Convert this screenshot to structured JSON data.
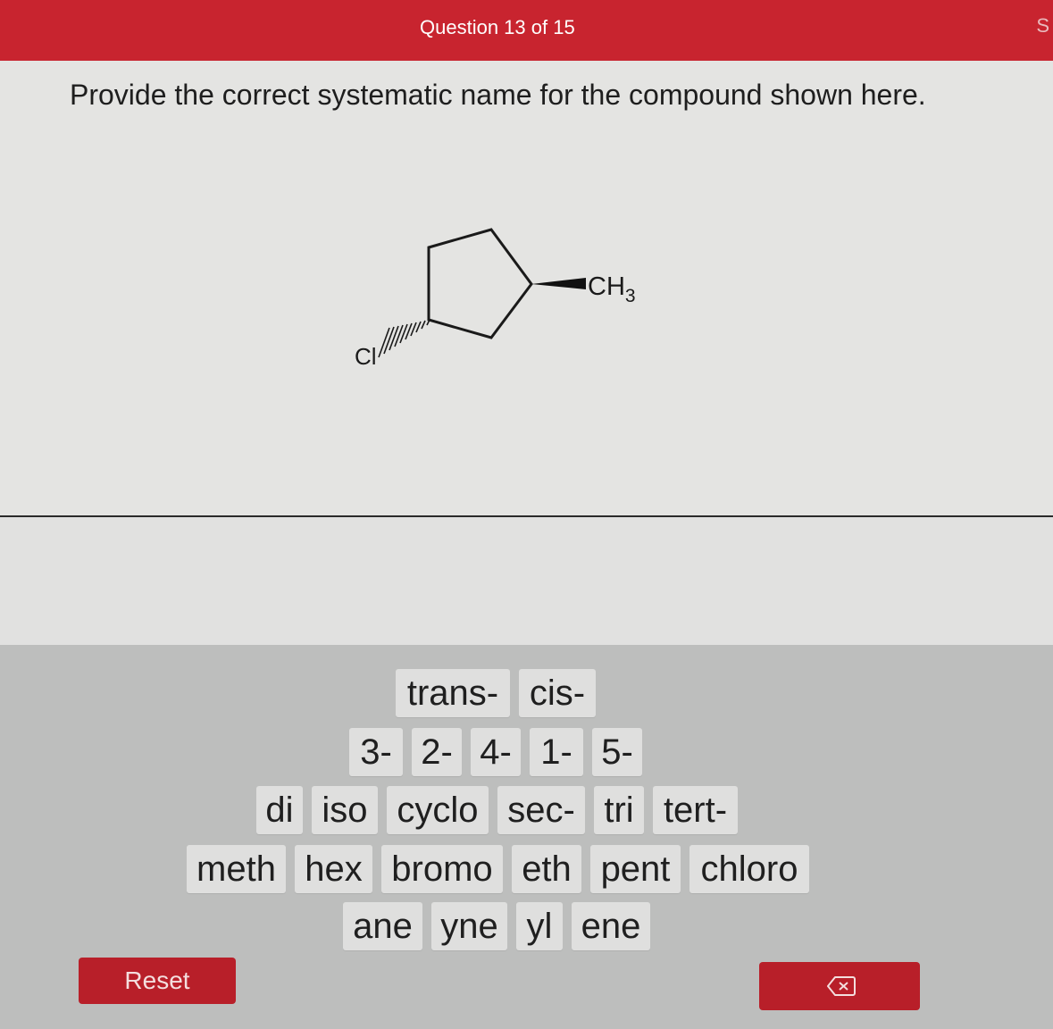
{
  "header": {
    "question_counter": "Question 13 of 15",
    "edge_letter": "S"
  },
  "question": {
    "prompt": "Provide the correct systematic name for the compound shown here.",
    "structure_labels": {
      "substituent_right": "CH",
      "substituent_right_subscript": "3",
      "substituent_left": "Cl"
    }
  },
  "tiles": {
    "row1": [
      "trans-",
      "cis-"
    ],
    "row2": [
      "3-",
      "2-",
      "4-",
      "1-",
      "5-"
    ],
    "row3": [
      "di",
      "iso",
      "cyclo",
      "sec-",
      "tri",
      "tert-"
    ],
    "row4": [
      "meth",
      "hex",
      "bromo",
      "eth",
      "pent",
      "chloro"
    ],
    "row5": [
      "ane",
      "yne",
      "yl",
      "ene"
    ]
  },
  "controls": {
    "reset_label": "Reset",
    "backspace_icon": "backspace-icon"
  },
  "colors": {
    "accent_red": "#c8242f",
    "button_red": "#b81f29",
    "tile_bg": "#dfdfde",
    "tray_bg": "#bdbebd"
  }
}
